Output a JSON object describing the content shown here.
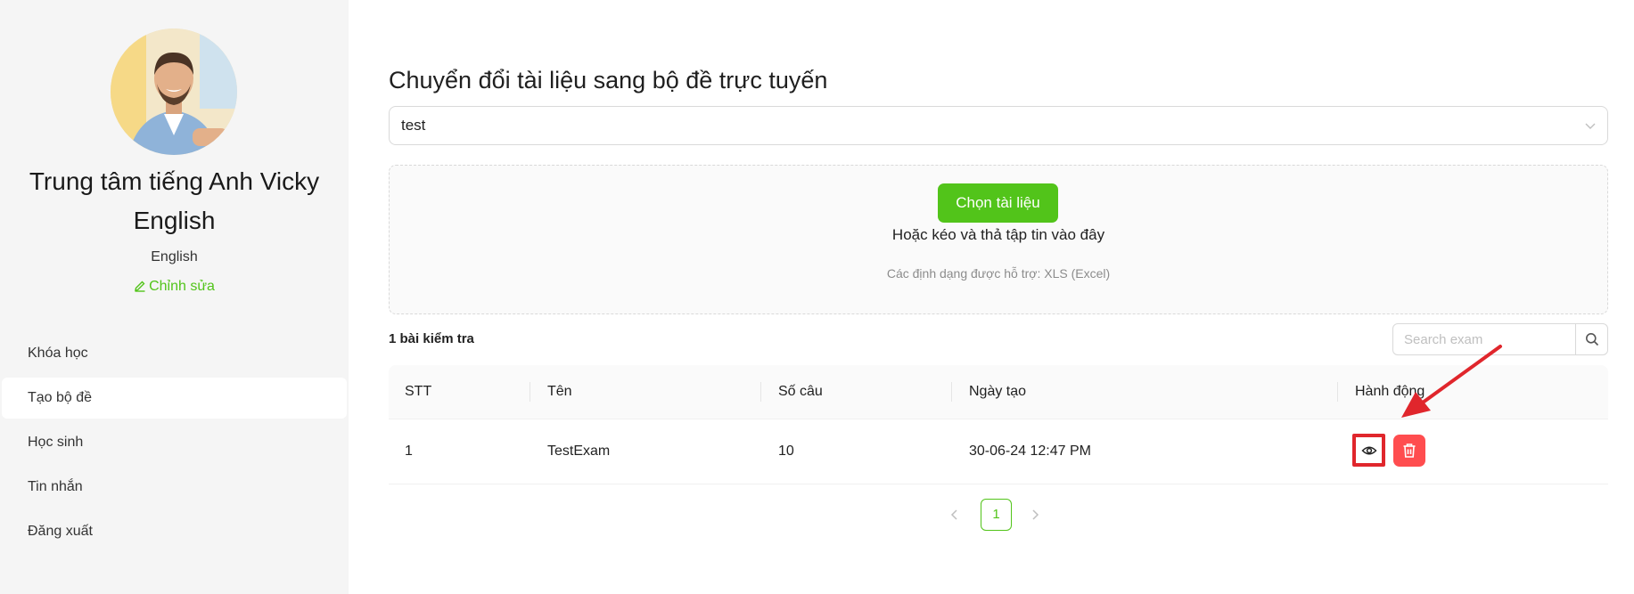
{
  "sidebar": {
    "org_name": "Trung tâm tiếng Anh Vicky English",
    "subject": "English",
    "edit_label": "Chỉnh sửa",
    "menu": [
      {
        "label": "Khóa học",
        "active": false
      },
      {
        "label": "Tạo bộ đề",
        "active": true
      },
      {
        "label": "Học sinh",
        "active": false
      },
      {
        "label": "Tin nhắn",
        "active": false
      },
      {
        "label": "Đăng xuất",
        "active": false
      }
    ]
  },
  "main": {
    "title": "Chuyển đổi tài liệu sang bộ đề trực tuyến",
    "select_value": "test",
    "upload": {
      "button_label": "Chọn tài liệu",
      "drop_text": "Hoặc kéo và thả tập tin vào đây",
      "formats": "Các định dạng được hỗ trợ: XLS (Excel)"
    },
    "count_label": "1 bài kiểm tra",
    "search_placeholder": "Search exam",
    "table": {
      "headers": [
        "STT",
        "Tên",
        "Số câu",
        "Ngày tạo",
        "Hành động"
      ],
      "rows": [
        {
          "stt": "1",
          "name": "TestExam",
          "questions": "10",
          "created": "30-06-24 12:47 PM"
        }
      ]
    },
    "pagination": {
      "current": "1"
    }
  },
  "colors": {
    "accent": "#52c41a",
    "danger": "#ff4d4f",
    "annotation": "#e0262c",
    "sidebar_bg": "#f5f5f5"
  },
  "icons": [
    "pencil-icon",
    "chevron-down-icon",
    "search-icon",
    "eye-icon",
    "trash-icon",
    "chevron-left-icon",
    "chevron-right-icon"
  ]
}
